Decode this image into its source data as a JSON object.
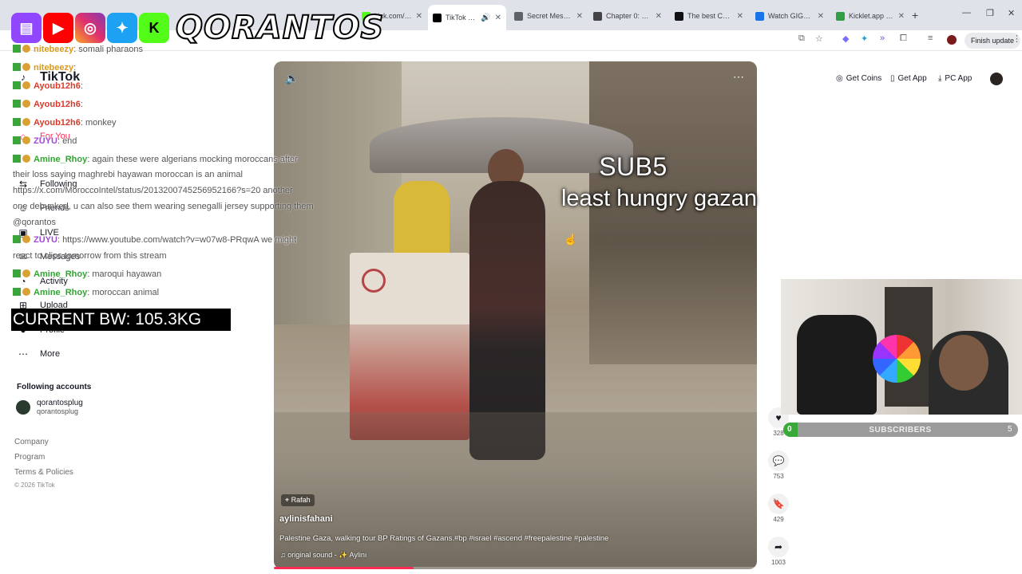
{
  "browser": {
    "tabs": [
      {
        "title": "kick.com/popo",
        "active": false,
        "favicon_color": "#53fc18"
      },
      {
        "title": "TikTok - Ma",
        "active": true,
        "favicon_color": "#000000"
      },
      {
        "title": "Secret Messag",
        "active": false,
        "favicon_color": "#5f6368"
      },
      {
        "title": "Chapter 0: Pro",
        "active": false,
        "favicon_color": "#444444"
      },
      {
        "title": "The best Chatt",
        "active": false,
        "favicon_color": "#111111"
      },
      {
        "title": "Watch GIGA C",
        "active": false,
        "favicon_color": "#1a73e8"
      },
      {
        "title": "Kicklet.app - K",
        "active": false,
        "favicon_color": "#2f9e44"
      }
    ],
    "finish_update": "Finish update"
  },
  "sidebar": {
    "brand": "TikTok",
    "items": [
      {
        "icon": "home-icon",
        "label": "For You"
      },
      {
        "icon": "following-icon",
        "label": "Following"
      },
      {
        "icon": "friends-icon",
        "label": "Friends"
      },
      {
        "icon": "live-icon",
        "label": "LIVE"
      },
      {
        "icon": "messages-icon",
        "label": "Messages"
      },
      {
        "icon": "activity-icon",
        "label": "Activity"
      },
      {
        "icon": "upload-icon",
        "label": "Upload"
      },
      {
        "icon": "profile-icon",
        "label": "Profile"
      },
      {
        "icon": "more-icon",
        "label": "More"
      }
    ],
    "following_accounts_title": "Following accounts",
    "account_name": "qorantosplug",
    "account_handle": "qorantosplug",
    "footer": [
      "Company",
      "Program",
      "Terms & Policies"
    ],
    "copyright": "© 2026 TikTok"
  },
  "header": {
    "get_coins": "Get Coins",
    "get_app": "Get App",
    "pc_app": "PC App"
  },
  "video": {
    "overlay_title": "SUB5",
    "overlay_sub": "least hungry gazan",
    "location": "Rafah",
    "author": "aylinisfahani",
    "caption": "Palestine Gaza, walking tour BP Ratings of Gazans.#bp #israel #ascend #freepalestine #palestine",
    "sound": "original sound - ✨ Aylinı",
    "progress": 0.29
  },
  "actions": {
    "likes": "328",
    "comments": "753",
    "saves": "429",
    "shares": "1003"
  },
  "stream": {
    "streamer": "QORANTOS",
    "bodyweight": "CURRENT BW: 105.3KG",
    "subs_current": "0",
    "subs_label": "SUBSCRIBERS",
    "subs_goal": "5",
    "subs_progress": 0.0
  },
  "chat": [
    {
      "user": "nitebeezy",
      "color": "#d99a1c",
      "msg": ": somali pharaons"
    },
    {
      "user": "nitebeezy",
      "color": "#d99a1c",
      "msg": ":"
    },
    {
      "user": "Ayoub12h6",
      "color": "#d93a2a",
      "msg": ":"
    },
    {
      "user": "Ayoub12h6",
      "color": "#d93a2a",
      "msg": ":"
    },
    {
      "user": "Ayoub12h6",
      "color": "#d93a2a",
      "msg": ": monkey"
    },
    {
      "user": "ZUYU",
      "color": "#a04ad9",
      "msg": ": end"
    },
    {
      "user": "Amine_Rhoy",
      "color": "#2fa62f",
      "msg": ": again these were algerians mocking moroccans after"
    },
    {
      "user": "ZUYU",
      "color": "#a04ad9",
      "msg": ": https://www.youtube.com/watch?v=w07w8-PRqwA we might"
    },
    {
      "user": "Amine_Rhoy",
      "color": "#2fa62f",
      "msg": ": maroqui hayawan"
    },
    {
      "user": "Amine_Rhoy",
      "color": "#2fa62f",
      "msg": ": moroccan animal"
    }
  ],
  "chat_continuations": [
    "their loss saying maghrebi hayawan moroccan is an animal",
    "https://x.com/MoroccoIntel/status/2013200745256952166?s=20 another",
    "one debunked, u can also see them wearing senegalli jersey supporting them",
    "@qorantos",
    "react to clips tomorrow from this stream"
  ]
}
